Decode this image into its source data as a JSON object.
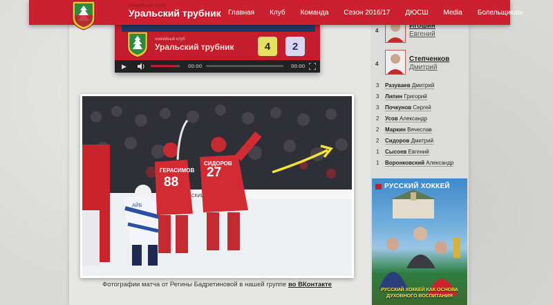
{
  "header": {
    "logo_subtitle": "хоккейный клуб",
    "logo_title": "Уральский трубник",
    "nav": [
      "Главная",
      "Клуб",
      "Команда",
      "Сезон 2016/17",
      "ДЮСШ",
      "Media",
      "Болельщикам"
    ]
  },
  "video": {
    "subtitle": "хоккейный клуб",
    "title": "Уральский трубник",
    "score_home": "4",
    "score_away": "2",
    "time_current": "00:00",
    "time_total": "00:00"
  },
  "photo": {
    "players": [
      {
        "name": "ГЕРАСИМОВ",
        "number": "88"
      },
      {
        "name": "СИДОРОВ",
        "number": "27"
      }
    ],
    "board_text": "УРАЛЬСКИЙ",
    "opponent_text": "АЙБ"
  },
  "caption": {
    "text": "Фотографии матча от Регины Бадретиновой в нашей группе",
    "link": "во ВКонтакте"
  },
  "sidebar": {
    "top_players": [
      {
        "count": "4",
        "last": "Игошин",
        "first": "Евгений"
      },
      {
        "count": "4",
        "last": "Степченков",
        "first": "Дмитрий"
      }
    ],
    "list": [
      {
        "count": "3",
        "last": "Разуваев",
        "first": "Дмитрий"
      },
      {
        "count": "3",
        "last": "Липин",
        "first": "Григорий"
      },
      {
        "count": "3",
        "last": "Почкунов",
        "first": "Сергей"
      },
      {
        "count": "2",
        "last": "Усов",
        "first": "Александр"
      },
      {
        "count": "2",
        "last": "Маркин",
        "first": "Вячеслав"
      },
      {
        "count": "2",
        "last": "Сидоров",
        "first": "Дмитрий"
      },
      {
        "count": "1",
        "last": "Сысоев",
        "first": "Евгений"
      },
      {
        "count": "1",
        "last": "Воронковский",
        "first": "Александр"
      }
    ]
  },
  "ad": {
    "title": "РУССКИЙ ХОККЕЙ",
    "line1": "РУССКИЙ ХОККЕЙ КАК ОСНОВА",
    "line2": "ДУХОВНОГО ВОСПИТАНИЯ"
  },
  "colors": {
    "brand_red": "#cc1f2f",
    "highlight_arrow": "#f3e23a"
  }
}
